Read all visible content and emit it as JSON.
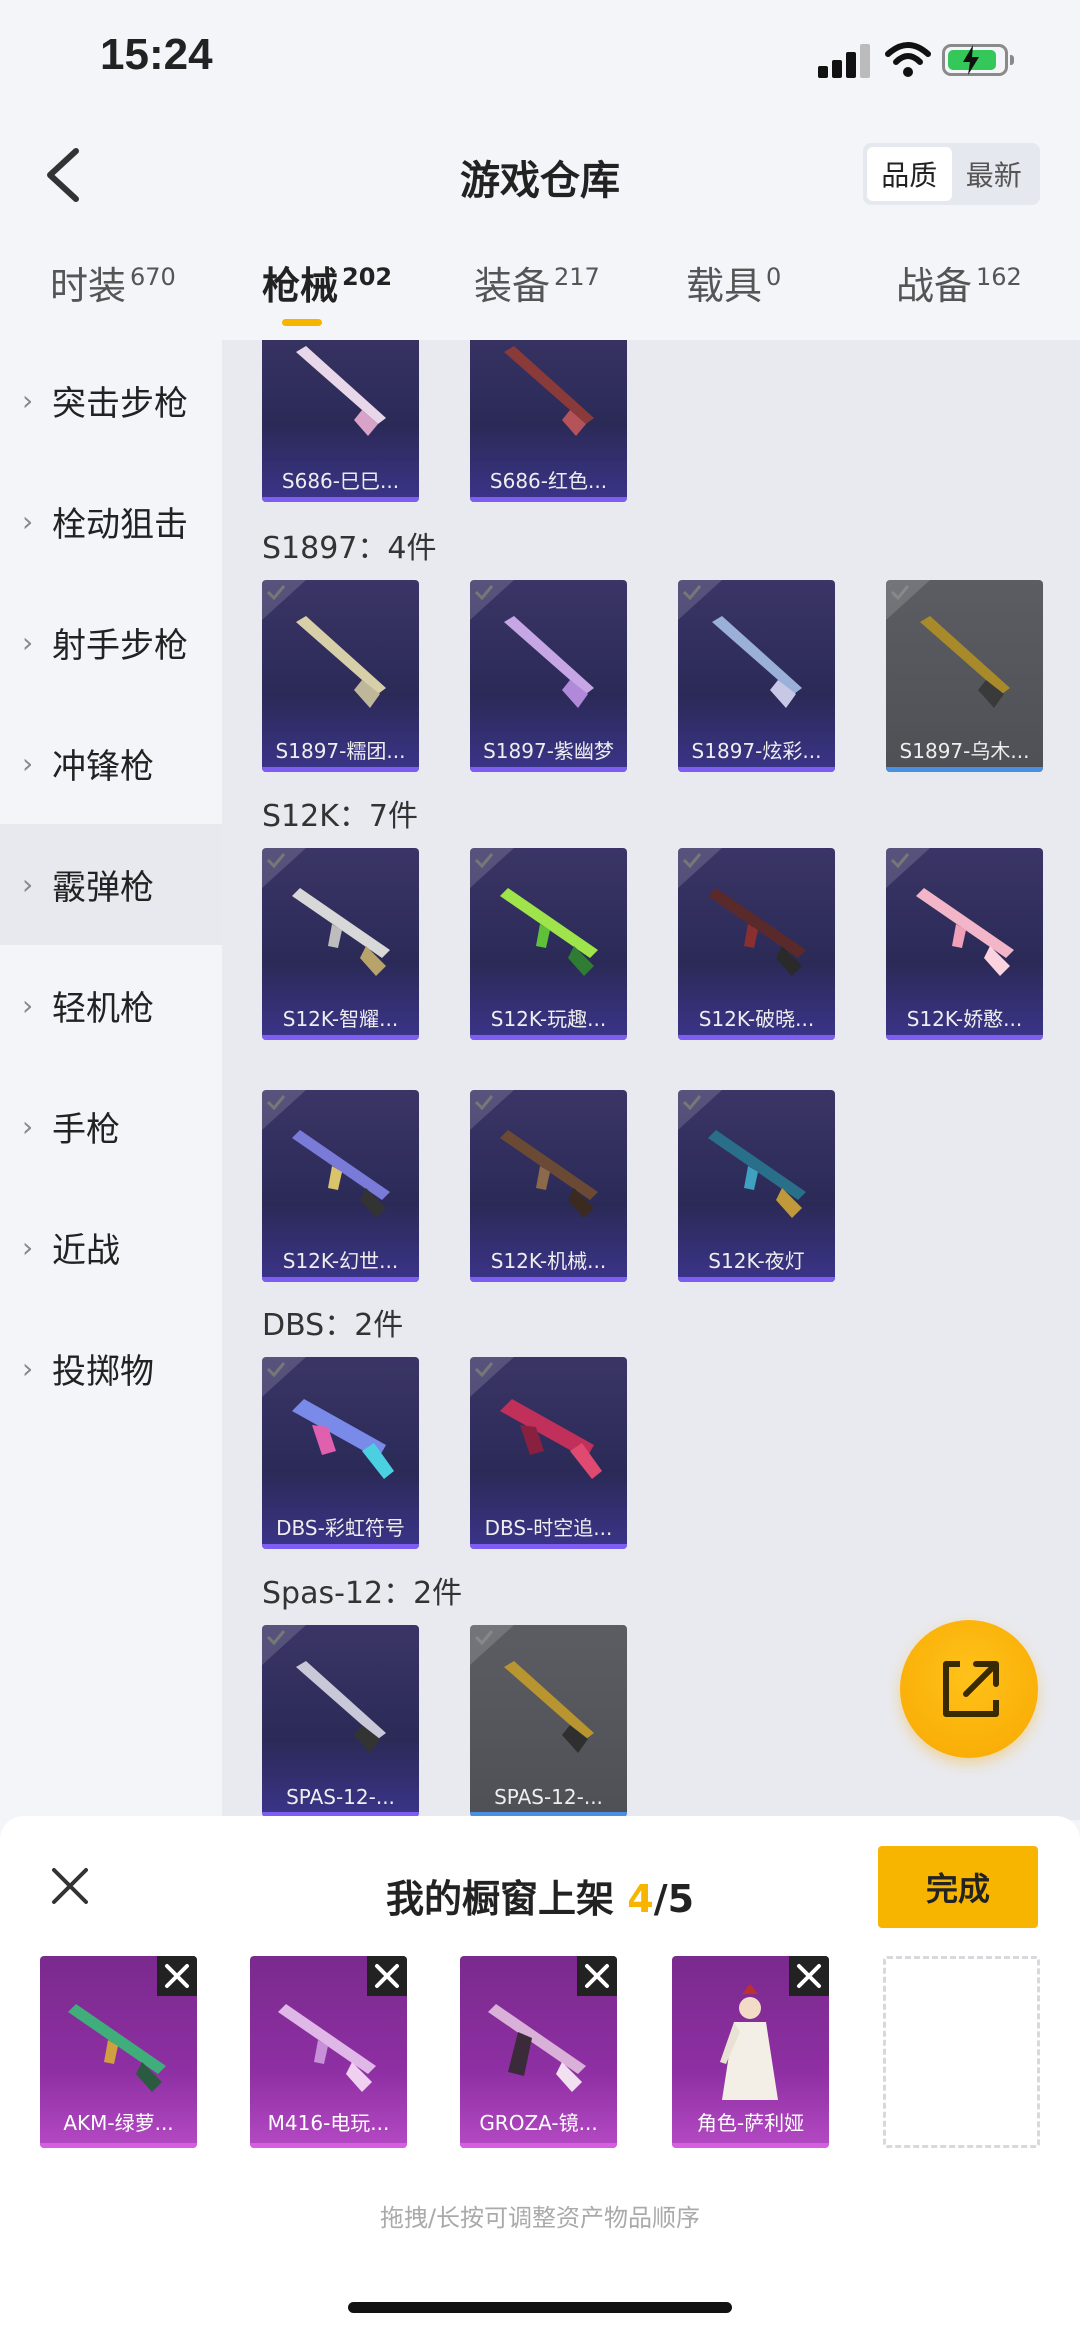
{
  "status": {
    "time": "15:24"
  },
  "header": {
    "title": "游戏仓库",
    "sort": [
      "品质",
      "最新"
    ]
  },
  "tabs": [
    {
      "label": "时装",
      "count": "670"
    },
    {
      "label": "枪械",
      "count": "202"
    },
    {
      "label": "装备",
      "count": "217"
    },
    {
      "label": "载具",
      "count": "0"
    },
    {
      "label": "战备",
      "count": "162"
    }
  ],
  "sidebar": [
    "突击步枪",
    "栓动狙击",
    "射手步枪",
    "冲锋枪",
    "霰弹枪",
    "轻机枪",
    "手枪",
    "近战",
    "投掷物"
  ],
  "content": {
    "top_row": [
      "S686-巳巳...",
      "S686-红色..."
    ],
    "sections": [
      {
        "title": "S1897：4件",
        "items": [
          "S1897-糯团...",
          "S1897-紫幽梦",
          "S1897-炫彩...",
          "S1897-乌木..."
        ]
      },
      {
        "title": "S12K：7件",
        "items": [
          "S12K-智耀...",
          "S12K-玩趣...",
          "S12K-破晓...",
          "S12K-娇憨...",
          "S12K-幻世...",
          "S12K-机械...",
          "S12K-夜灯"
        ]
      },
      {
        "title": "DBS：2件",
        "items": [
          "DBS-彩虹符号",
          "DBS-时空追..."
        ]
      },
      {
        "title": "Spas-12：2件",
        "items": [
          "SPAS-12-...",
          "SPAS-12-..."
        ]
      }
    ]
  },
  "sheet": {
    "title_prefix": "我的橱窗上架",
    "current": "4",
    "total": "/5",
    "done": "完成",
    "items": [
      "AKM-绿萝...",
      "M416-电玩...",
      "GROZA-镜...",
      "角色-萨利娅"
    ],
    "hint": "拖拽/长按可调整资产物品顺序"
  }
}
